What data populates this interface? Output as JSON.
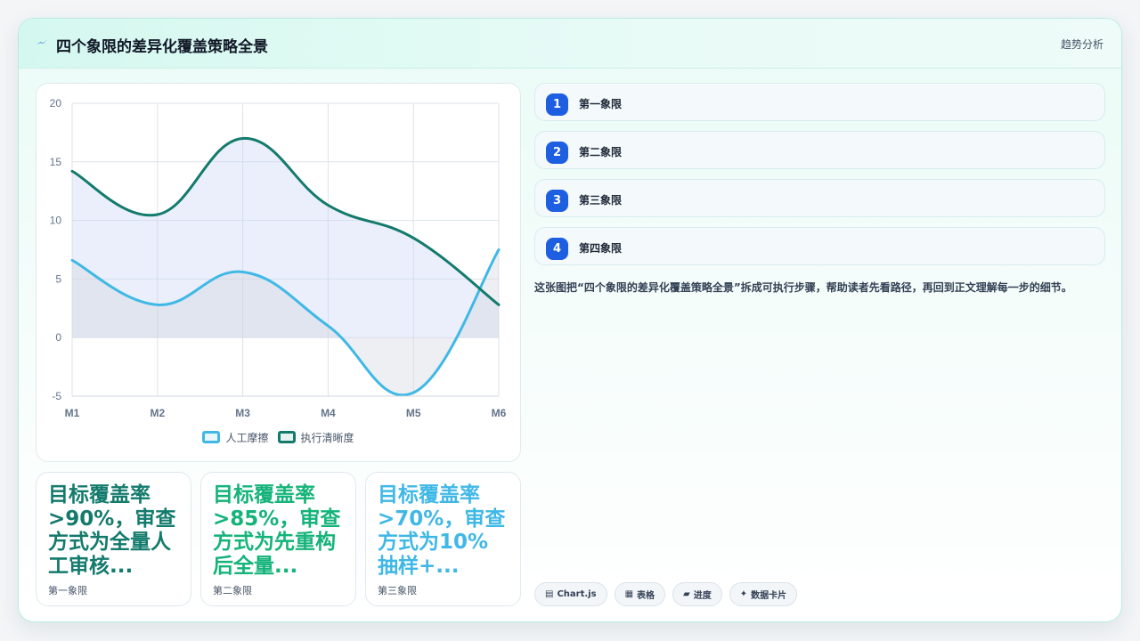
{
  "header": {
    "title": "四个象限的差异化覆盖策略全景",
    "tag": "趋势分析",
    "title_icon": "lightning-icon"
  },
  "chart_data": {
    "type": "line",
    "categories": [
      "M1",
      "M2",
      "M3",
      "M4",
      "M5",
      "M6"
    ],
    "ylim": [
      -5,
      20
    ],
    "yticks": [
      -5,
      0,
      5,
      10,
      15,
      20
    ],
    "grid": true,
    "legend": "bottom",
    "fill": true,
    "smooth": true,
    "series": [
      {
        "name": "人工摩擦",
        "values": [
          6.6,
          2.8,
          5.6,
          1.0,
          -4.7,
          7.5
        ],
        "color": "#40b8e6",
        "fill": "rgba(210,214,222,0.38)"
      },
      {
        "name": "执行清晰度",
        "values": [
          14.2,
          10.5,
          17.0,
          11.3,
          8.5,
          2.8
        ],
        "color": "#137a6c",
        "fill": "rgba(200,214,245,0.38)"
      }
    ]
  },
  "stats": [
    {
      "value": "目标覆盖率>90%，审查方式为全量人工审核...",
      "label": "第一象限",
      "color": "#137a6c"
    },
    {
      "value": "目标覆盖率>85%，审查方式为先重构后全量...",
      "label": "第二象限",
      "color": "#14b37a"
    },
    {
      "value": "目标覆盖率>70%，审查方式为10%抽样+...",
      "label": "第三象限",
      "color": "#40b8e6"
    }
  ],
  "steps": [
    {
      "num": "1",
      "label": "第一象限"
    },
    {
      "num": "2",
      "label": "第二象限"
    },
    {
      "num": "3",
      "label": "第三象限"
    },
    {
      "num": "4",
      "label": "第四象限"
    }
  ],
  "description": "这张图把“四个象限的差异化覆盖策略全景”拆成可执行步骤，帮助读者先看路径，再回到正文理解每一步的细节。",
  "tools": [
    {
      "icon": "▤",
      "label": "Chart.js"
    },
    {
      "icon": "▦",
      "label": "表格"
    },
    {
      "icon": "▰",
      "label": "进度"
    },
    {
      "icon": "✦",
      "label": "数据卡片"
    }
  ]
}
